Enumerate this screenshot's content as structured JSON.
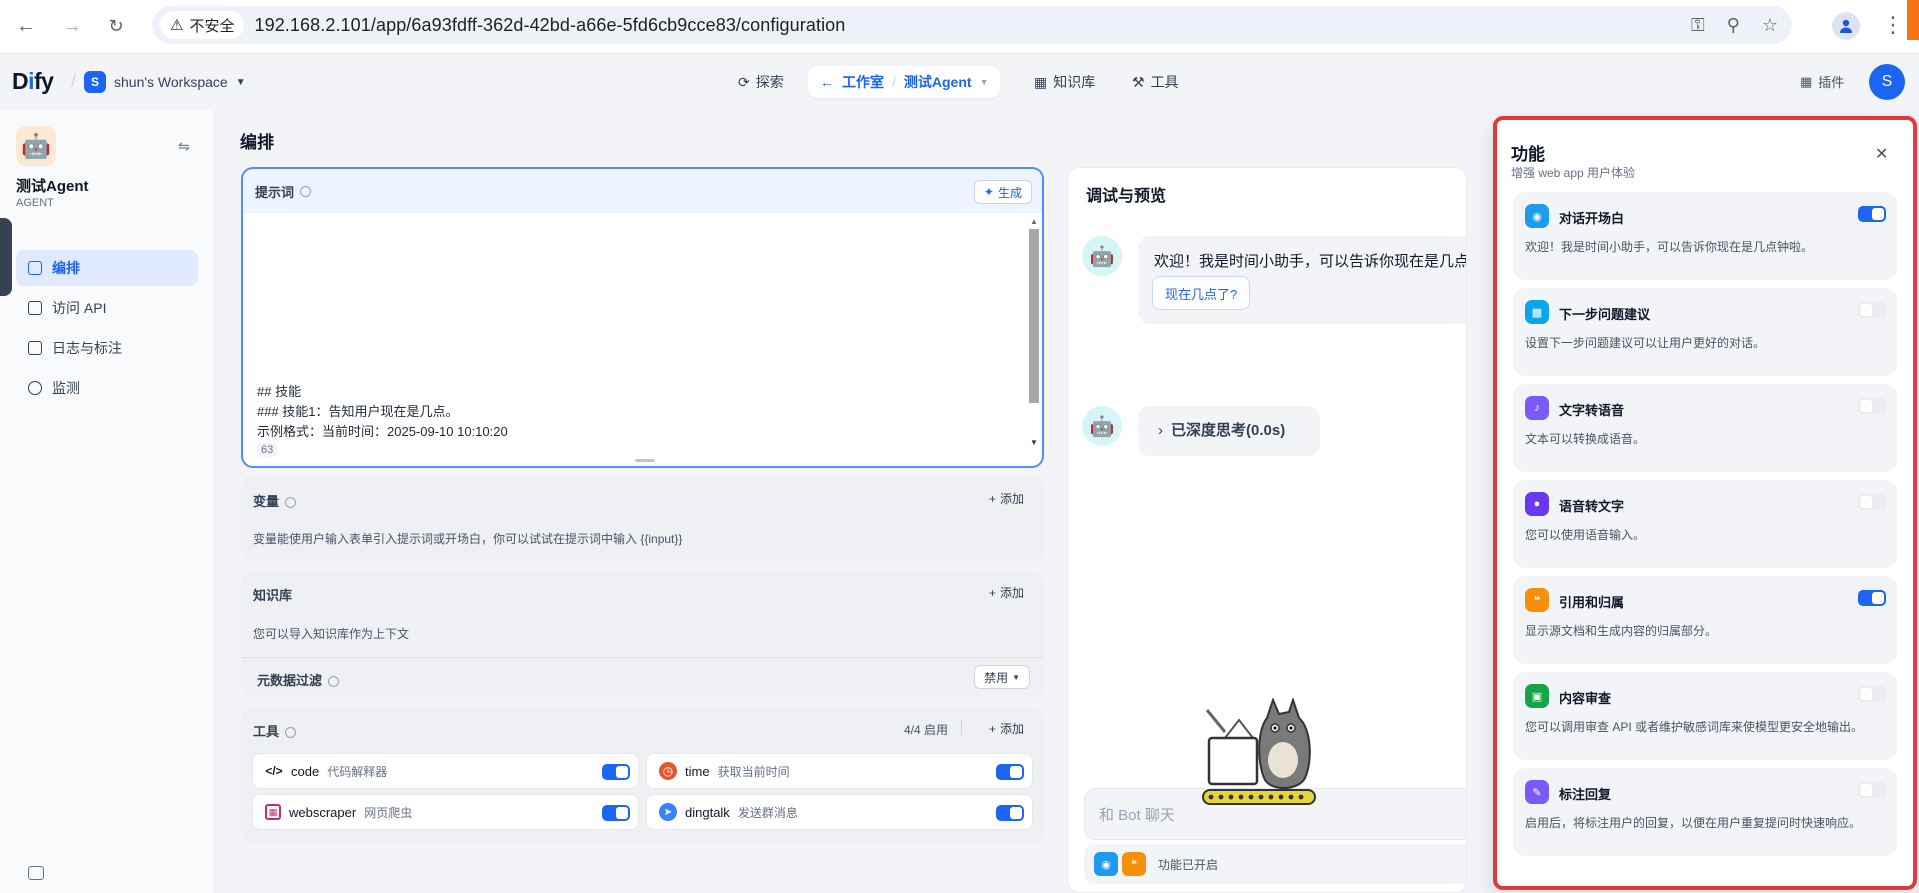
{
  "browser": {
    "insecure_label": "不安全",
    "url": "192.168.2.101/app/6a93fdff-362d-42bd-a66e-5fd6cb9cce83/configuration"
  },
  "topbar": {
    "logo_prefix": "D",
    "logo_i": "i",
    "logo_suffix": "fy",
    "workspace_badge": "S",
    "workspace_name": "shun's Workspace",
    "explore": "探索",
    "studio": "工作室",
    "app_crumb": "测试Agent",
    "knowledge": "知识库",
    "tools": "工具",
    "plugins": "插件",
    "avatar": "S"
  },
  "sidebar": {
    "app_name": "测试Agent",
    "app_type": "AGENT",
    "items": [
      {
        "label": "编排"
      },
      {
        "label": "访问 API"
      },
      {
        "label": "日志与标注"
      },
      {
        "label": "监测"
      }
    ]
  },
  "editor": {
    "title": "编排",
    "prompt": {
      "title": "提示词",
      "generate": "生成",
      "line1": "## 技能",
      "line2": "### 技能1：告知用户现在是几点。",
      "line3": "示例格式：当前时间：2025-09-10 10:10:20",
      "count": "63"
    },
    "variables": {
      "title": "变量",
      "add": "添加",
      "desc": "变量能使用户输入表单引入提示词或开场白，你可以试试在提示词中输入 {{input}}"
    },
    "knowledge": {
      "title": "知识库",
      "add": "添加",
      "desc": "您可以导入知识库作为上下文",
      "metadata_filter": "元数据过滤",
      "disabled": "禁用"
    },
    "tools": {
      "title": "工具",
      "count": "4/4 启用",
      "add": "添加",
      "items": [
        {
          "name": "code",
          "desc": "代码解释器"
        },
        {
          "name": "time",
          "desc": "获取当前时间"
        },
        {
          "name": "webscraper",
          "desc": "网页爬虫"
        },
        {
          "name": "dingtalk",
          "desc": "发送群消息"
        }
      ]
    }
  },
  "debug": {
    "title": "调试与预览",
    "welcome": "欢迎！我是时间小助手，可以告诉你现在是几点钟啦。",
    "suggested_question": "现在几点了?",
    "thinking": "已深度思考(0.0s)",
    "input_placeholder": "和 Bot 聊天",
    "features_enabled": "功能已开启"
  },
  "features": {
    "title": "功能",
    "subtitle": "增强 web app 用户体验",
    "items": [
      {
        "title": "对话开场白",
        "desc": "欢迎！我是时间小助手，可以告诉你现在是几点钟啦。",
        "enabled": true,
        "color": "#1c9bf0"
      },
      {
        "title": "下一步问题建议",
        "desc": "设置下一步问题建议可以让用户更好的对话。",
        "enabled": false,
        "color": "#0ba5ec"
      },
      {
        "title": "文字转语音",
        "desc": "文本可以转换成语音。",
        "enabled": false,
        "color": "#7a5af8"
      },
      {
        "title": "语音转文字",
        "desc": "您可以使用语音输入。",
        "enabled": false,
        "color": "#6938ef"
      },
      {
        "title": "引用和归属",
        "desc": "显示源文档和生成内容的归属部分。",
        "enabled": true,
        "color": "#f79009"
      },
      {
        "title": "内容审查",
        "desc": "您可以调用审查 API 或者维护敏感词库来使模型更安全地输出。",
        "enabled": false,
        "color": "#16a34a"
      },
      {
        "title": "标注回复",
        "desc": "启用后，将标注用户的回复，以便在用户重复提问时快速响应。",
        "enabled": false,
        "color": "#7a5af8"
      }
    ]
  }
}
